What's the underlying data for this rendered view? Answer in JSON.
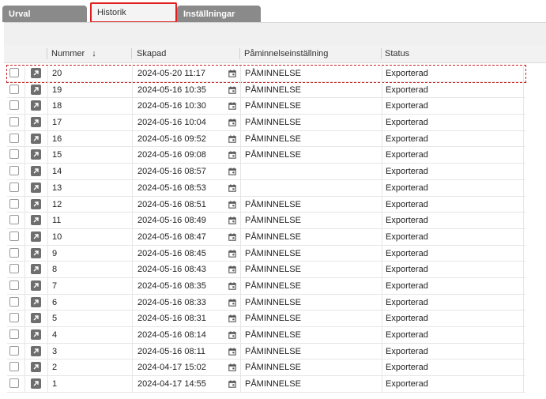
{
  "tabs": [
    {
      "label": "Urval",
      "active": false
    },
    {
      "label": "Historik",
      "active": true
    },
    {
      "label": "Inställningar",
      "active": false
    }
  ],
  "columns": {
    "number": "Nummer",
    "sort_indicator": "↓",
    "created": "Skapad",
    "reminder": "Påminnelseinställning",
    "status": "Status"
  },
  "rows": [
    {
      "number": "20",
      "created": "2024-05-20 11:17",
      "reminder": "PÅMINNELSE",
      "status": "Exporterad",
      "selected": true
    },
    {
      "number": "19",
      "created": "2024-05-16 10:35",
      "reminder": "PÅMINNELSE",
      "status": "Exporterad"
    },
    {
      "number": "18",
      "created": "2024-05-16 10:30",
      "reminder": "PÅMINNELSE",
      "status": "Exporterad"
    },
    {
      "number": "17",
      "created": "2024-05-16 10:04",
      "reminder": "PÅMINNELSE",
      "status": "Exporterad"
    },
    {
      "number": "16",
      "created": "2024-05-16 09:52",
      "reminder": "PÅMINNELSE",
      "status": "Exporterad"
    },
    {
      "number": "15",
      "created": "2024-05-16 09:08",
      "reminder": "PÅMINNELSE",
      "status": "Exporterad"
    },
    {
      "number": "14",
      "created": "2024-05-16 08:57",
      "reminder": "",
      "status": "Exporterad"
    },
    {
      "number": "13",
      "created": "2024-05-16 08:53",
      "reminder": "",
      "status": "Exporterad"
    },
    {
      "number": "12",
      "created": "2024-05-16 08:51",
      "reminder": "PÅMINNELSE",
      "status": "Exporterad"
    },
    {
      "number": "11",
      "created": "2024-05-16 08:49",
      "reminder": "PÅMINNELSE",
      "status": "Exporterad"
    },
    {
      "number": "10",
      "created": "2024-05-16 08:47",
      "reminder": "PÅMINNELSE",
      "status": "Exporterad"
    },
    {
      "number": "9",
      "created": "2024-05-16 08:45",
      "reminder": "PÅMINNELSE",
      "status": "Exporterad"
    },
    {
      "number": "8",
      "created": "2024-05-16 08:43",
      "reminder": "PÅMINNELSE",
      "status": "Exporterad"
    },
    {
      "number": "7",
      "created": "2024-05-16 08:35",
      "reminder": "PÅMINNELSE",
      "status": "Exporterad"
    },
    {
      "number": "6",
      "created": "2024-05-16 08:33",
      "reminder": "PÅMINNELSE",
      "status": "Exporterad"
    },
    {
      "number": "5",
      "created": "2024-05-16 08:31",
      "reminder": "PÅMINNELSE",
      "status": "Exporterad"
    },
    {
      "number": "4",
      "created": "2024-05-16 08:14",
      "reminder": "PÅMINNELSE",
      "status": "Exporterad"
    },
    {
      "number": "3",
      "created": "2024-05-16 08:11",
      "reminder": "PÅMINNELSE",
      "status": "Exporterad"
    },
    {
      "number": "2",
      "created": "2024-04-17 15:02",
      "reminder": "PÅMINNELSE",
      "status": "Exporterad"
    },
    {
      "number": "1",
      "created": "2024-04-17 14:55",
      "reminder": "PÅMINNELSE",
      "status": "Exporterad"
    }
  ],
  "icons": {
    "open": "arrow-up-right-icon",
    "calendar": "calendar-icon"
  },
  "colors": {
    "tab_inactive": "#8a8a8a",
    "highlight_border": "#e02020",
    "open_icon_bg": "#6e6e6e"
  }
}
